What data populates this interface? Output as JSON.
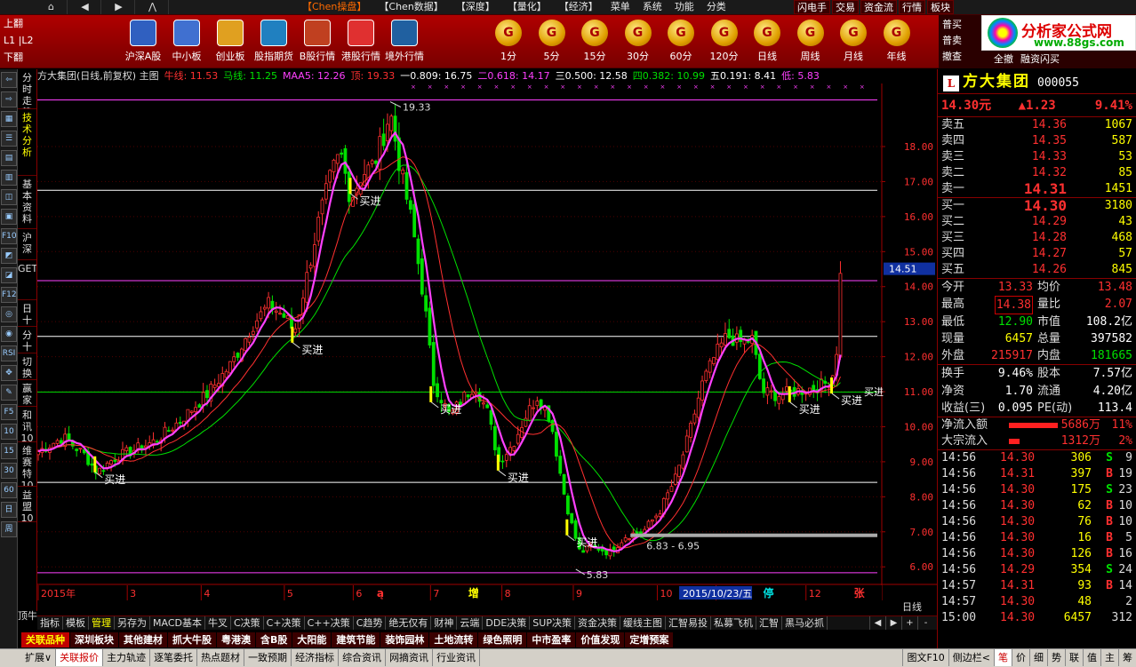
{
  "menubar": {
    "nav": [
      "⌂",
      "◀",
      "▶",
      "⋀"
    ],
    "items": [
      "【Chen操盘】",
      "【Chen数据】",
      "【深度】",
      "【量化】",
      "【经济】",
      "菜单",
      "系统",
      "功能",
      "分类"
    ],
    "highlight_index": 0,
    "right_buttons": [
      "闪电手",
      "交易",
      "资金流",
      "行情",
      "板块"
    ]
  },
  "toolbar": {
    "left": [
      "上翻",
      "L1 |L2",
      "下翻"
    ],
    "items": [
      {
        "label": "沪深A股",
        "icon": "chart-grid-icon"
      },
      {
        "label": "中小板",
        "icon": "tiles-icon"
      },
      {
        "label": "创业板",
        "icon": "pencil-chart-icon"
      },
      {
        "label": "股指期货",
        "icon": "futures-icon"
      },
      {
        "label": "B股行情",
        "icon": "building-icon"
      },
      {
        "label": "港股行情",
        "icon": "hk-flower-icon"
      },
      {
        "label": "境外行情",
        "icon": "globe-search-icon"
      }
    ],
    "periods": [
      "1分",
      "5分",
      "15分",
      "30分",
      "60分",
      "120分",
      "日线",
      "周线",
      "月线",
      "年线"
    ],
    "coin_glyph": "G"
  },
  "logo": {
    "name": "分析家公式网",
    "url": "www.88gs.com",
    "side": [
      "普买",
      "普卖",
      "撤查"
    ],
    "bottom": [
      "全撤",
      "融资闪买"
    ]
  },
  "chart_header": {
    "title": "方大集团(日线,前复权) 主图",
    "items": [
      {
        "text": "牛线: 11.53",
        "color": "#ff3030"
      },
      {
        "text": "马线: 11.25",
        "color": "#00e000"
      },
      {
        "text": "MAA5: 12.26",
        "color": "#ff40ff"
      },
      {
        "text": "顶: 19.33",
        "color": "#ff3030"
      },
      {
        "text": "一0.809: 16.75",
        "color": "#ffffff"
      },
      {
        "text": "二0.618: 14.17",
        "color": "#ff40ff"
      },
      {
        "text": "三0.500: 12.58",
        "color": "#ffffff"
      },
      {
        "text": "四0.382: 10.99",
        "color": "#00e000"
      },
      {
        "text": "五0.191: 8.41",
        "color": "#ffffff"
      },
      {
        "text": "低: 5.83",
        "color": "#ff40ff"
      }
    ]
  },
  "chart_data": {
    "type": "candlestick",
    "y_ticks": [
      6.0,
      7.0,
      8.0,
      9.0,
      10.0,
      11.0,
      12.0,
      13.0,
      14.0,
      15.0,
      16.0,
      17.0,
      18.0
    ],
    "ylim": [
      5.6,
      19.8
    ],
    "current_price_tag": "14.51",
    "month_labels": [
      {
        "label": "2015年",
        "pos": 0.0
      },
      {
        "label": "3",
        "pos": 0.106
      },
      {
        "label": "4",
        "pos": 0.194
      },
      {
        "label": "5",
        "pos": 0.293
      },
      {
        "label": "6",
        "pos": 0.375
      },
      {
        "label": "7",
        "pos": 0.467
      },
      {
        "label": "8",
        "pos": 0.552
      },
      {
        "label": "9",
        "pos": 0.637
      },
      {
        "label": "10",
        "pos": 0.737
      },
      {
        "label": "11",
        "pos": 0.807
      },
      {
        "label": "12",
        "pos": 0.914
      }
    ],
    "special_labels": [
      {
        "label": "ą",
        "pos": 0.403,
        "color": "#ff3030"
      },
      {
        "label": "增",
        "pos": 0.512,
        "color": "#ffff00"
      },
      {
        "label": "财",
        "pos": 0.777,
        "color": "#4080ff"
      },
      {
        "label": "停",
        "pos": 0.863,
        "color": "#00e0e0"
      },
      {
        "label": "张",
        "pos": 0.971,
        "color": "#ff3030"
      }
    ],
    "date_box": "2015/10/23/五",
    "fib_levels": [
      {
        "name": "顶",
        "value": 19.33,
        "color": "#ff40ff"
      },
      {
        "name": "一0.809",
        "value": 16.75,
        "color": "#ffffff"
      },
      {
        "name": "二0.618",
        "value": 14.17,
        "color": "#ff40ff"
      },
      {
        "name": "三0.500",
        "value": 12.58,
        "color": "#ffffff"
      },
      {
        "name": "四0.382",
        "value": 10.99,
        "color": "#00e000"
      },
      {
        "name": "五0.191",
        "value": 8.41,
        "color": "#ffffff"
      },
      {
        "name": "低",
        "value": 5.83,
        "color": "#ff40ff"
      }
    ],
    "annotations": {
      "high": {
        "label": "19.33",
        "pos": 0.419,
        "value": 19.33
      },
      "low": {
        "label": "5.83",
        "pos": 0.64,
        "value": 5.83
      },
      "range": {
        "label": "6.83 - 6.95",
        "pos": 0.705,
        "value": 6.9
      },
      "buy_label": "买进",
      "buy_signals": [
        {
          "pos": 0.068,
          "value": 8.75
        },
        {
          "pos": 0.372,
          "value": 16.7
        },
        {
          "pos": 0.303,
          "value": 12.45
        },
        {
          "pos": 0.468,
          "value": 10.75
        },
        {
          "pos": 0.548,
          "value": 8.8
        },
        {
          "pos": 0.63,
          "value": 6.95
        },
        {
          "pos": 0.895,
          "value": 10.75
        },
        {
          "pos": 0.945,
          "value": 11.0
        }
      ]
    },
    "close_anchors": [
      [
        0.0,
        9.3
      ],
      [
        0.03,
        9.7
      ],
      [
        0.055,
        9.2
      ],
      [
        0.07,
        8.7
      ],
      [
        0.09,
        9.1
      ],
      [
        0.11,
        9.3
      ],
      [
        0.14,
        9.6
      ],
      [
        0.17,
        10.2
      ],
      [
        0.2,
        10.9
      ],
      [
        0.23,
        11.8
      ],
      [
        0.255,
        12.9
      ],
      [
        0.275,
        13.5
      ],
      [
        0.295,
        13.1
      ],
      [
        0.305,
        12.7
      ],
      [
        0.32,
        14.3
      ],
      [
        0.335,
        16.0
      ],
      [
        0.35,
        17.3
      ],
      [
        0.36,
        17.8
      ],
      [
        0.372,
        16.5
      ],
      [
        0.385,
        17.2
      ],
      [
        0.4,
        17.5
      ],
      [
        0.412,
        18.4
      ],
      [
        0.419,
        19.0
      ],
      [
        0.43,
        17.5
      ],
      [
        0.445,
        15.8
      ],
      [
        0.46,
        13.5
      ],
      [
        0.47,
        11.3
      ],
      [
        0.49,
        10.3
      ],
      [
        0.505,
        10.8
      ],
      [
        0.52,
        11.2
      ],
      [
        0.535,
        10.4
      ],
      [
        0.548,
        9.0
      ],
      [
        0.565,
        9.5
      ],
      [
        0.58,
        10.3
      ],
      [
        0.595,
        10.9
      ],
      [
        0.61,
        10.2
      ],
      [
        0.625,
        8.2
      ],
      [
        0.635,
        7.2
      ],
      [
        0.645,
        6.4
      ],
      [
        0.66,
        6.6
      ],
      [
        0.68,
        6.4
      ],
      [
        0.7,
        6.9
      ],
      [
        0.72,
        7.0
      ],
      [
        0.74,
        7.6
      ],
      [
        0.76,
        8.6
      ],
      [
        0.775,
        9.8
      ],
      [
        0.79,
        11.2
      ],
      [
        0.805,
        12.0
      ],
      [
        0.82,
        12.6
      ],
      [
        0.835,
        12.4
      ],
      [
        0.85,
        12.5
      ],
      [
        0.862,
        11.0
      ],
      [
        0.88,
        10.9
      ],
      [
        0.9,
        11.0
      ],
      [
        0.92,
        11.1
      ],
      [
        0.935,
        11.2
      ],
      [
        0.945,
        11.4
      ],
      [
        0.95,
        12.0
      ],
      [
        0.955,
        14.3
      ]
    ]
  },
  "lefttabs": [
    {
      "label": "分时走势",
      "active": false
    },
    {
      "label": "技术分析",
      "active": true
    },
    {
      "label": "基本资料",
      "active": false
    },
    {
      "label": "沪深",
      "active": false
    },
    {
      "label": "GET",
      "active": false
    },
    {
      "label": "日十",
      "active": false
    },
    {
      "label": "分十",
      "active": false
    },
    {
      "label": "切换",
      "active": false
    },
    {
      "label": "赢家",
      "active": false
    },
    {
      "label": "和讯10",
      "active": false
    },
    {
      "label": "维赛特10",
      "active": false
    },
    {
      "label": "益盟10",
      "active": false
    }
  ],
  "lefticons": [
    "⇦",
    "⇨",
    "▦",
    "☰",
    "▤",
    "▥",
    "◫",
    "▣",
    "F10",
    "◩",
    "◪",
    "F12",
    "◎",
    "◉",
    "RSI",
    "✥",
    "✎",
    "F5",
    "10",
    "15",
    "30",
    "60",
    "日",
    "周"
  ],
  "sidebar_v": "顶牛",
  "bottomtabs": [
    "指标",
    "模板",
    "管理",
    "另存为",
    "MACD基本",
    "牛叉",
    "C决策",
    "C+决策",
    "C++决策",
    "C趋势",
    "绝无仅有",
    "财神",
    "云端",
    "DDE决策",
    "SUP决策",
    "资金决策",
    "缓线主图",
    "汇智易投",
    "私募飞机",
    "汇智",
    "黑马必抓"
  ],
  "bottomtabs_active": 2,
  "timeframe": "日线",
  "navarrows": [
    "◀",
    "▶",
    "+",
    "-"
  ],
  "sectors": [
    "关联品种",
    "深圳板块",
    "其他建材",
    "抓大牛股",
    "粤港澳",
    "含B股",
    "大阳能",
    "建筑节能",
    "装饰园林",
    "土地流转",
    "绿色照明",
    "中市盈率",
    "价值发现",
    "定增预案"
  ],
  "statusbar": {
    "items": [
      "扩展∨",
      "关联报价",
      "主力轨迹",
      "逐笔委托",
      "热点题材",
      "一致预期",
      "经济指标",
      "综合资讯",
      "网摘资讯",
      "行业资讯"
    ],
    "active": 1,
    "right": [
      "图文F10",
      "侧边栏<",
      "笔",
      "价",
      "细",
      "势",
      "联",
      "值",
      "主",
      "筹"
    ]
  },
  "quote": {
    "logo": "L",
    "name": "方大集团",
    "code": "000055",
    "price": "14.30元",
    "change": "▲1.23",
    "change_pct": "9.41%",
    "asks": [
      {
        "label": "卖五",
        "price": "14.36",
        "vol": "1067"
      },
      {
        "label": "卖四",
        "price": "14.35",
        "vol": "587"
      },
      {
        "label": "卖三",
        "price": "14.33",
        "vol": "53"
      },
      {
        "label": "卖二",
        "price": "14.32",
        "vol": "85"
      },
      {
        "label": "卖一",
        "price": "14.31",
        "vol": "1451"
      }
    ],
    "bids": [
      {
        "label": "买一",
        "price": "14.30",
        "vol": "3180"
      },
      {
        "label": "买二",
        "price": "14.29",
        "vol": "43"
      },
      {
        "label": "买三",
        "price": "14.28",
        "vol": "468"
      },
      {
        "label": "买四",
        "price": "14.27",
        "vol": "57"
      },
      {
        "label": "买五",
        "price": "14.26",
        "vol": "845"
      }
    ],
    "stats": [
      {
        "k1": "今开",
        "v1": "13.33",
        "c1": "red",
        "k2": "均价",
        "v2": "13.48",
        "c2": "red"
      },
      {
        "k1": "最高",
        "v1": "14.38",
        "c1": "red",
        "b1": true,
        "k2": "量比",
        "v2": "2.07",
        "c2": "red"
      },
      {
        "k1": "最低",
        "v1": "12.90",
        "c1": "grn",
        "k2": "市值",
        "v2": "108.2亿",
        "c2": "wht"
      },
      {
        "k1": "现量",
        "v1": "6457",
        "c1": "yel",
        "k2": "总量",
        "v2": "397582",
        "c2": "wht"
      },
      {
        "k1": "外盘",
        "v1": "215917",
        "c1": "red",
        "k2": "内盘",
        "v2": "181665",
        "c2": "grn"
      }
    ],
    "stats2": [
      {
        "k1": "换手",
        "v1": "9.46%",
        "c1": "wht",
        "k2": "股本",
        "v2": "7.57亿",
        "c2": "wht"
      },
      {
        "k1": "净资",
        "v1": "1.70",
        "c1": "wht",
        "k2": "流通",
        "v2": "4.20亿",
        "c2": "wht"
      },
      {
        "k1": "收益(三)",
        "v1": "0.095",
        "c1": "wht",
        "k2": "PE(动)",
        "v2": "113.4",
        "c2": "wht"
      }
    ],
    "flows": [
      {
        "label": "净流入额",
        "value": "5686万",
        "pct": "11%",
        "bar": 0.55
      },
      {
        "label": "大宗流入",
        "value": "1312万",
        "pct": "2%",
        "bar": 0.12
      }
    ],
    "ticks": [
      {
        "t": "14:56",
        "p": "14.30",
        "v": "306",
        "s": "S",
        "n": "9"
      },
      {
        "t": "14:56",
        "p": "14.31",
        "v": "397",
        "s": "B",
        "n": "19"
      },
      {
        "t": "14:56",
        "p": "14.30",
        "v": "175",
        "s": "S",
        "n": "23"
      },
      {
        "t": "14:56",
        "p": "14.30",
        "v": "62",
        "s": "B",
        "n": "10"
      },
      {
        "t": "14:56",
        "p": "14.30",
        "v": "76",
        "s": "B",
        "n": "10"
      },
      {
        "t": "14:56",
        "p": "14.30",
        "v": "16",
        "s": "B",
        "n": "5"
      },
      {
        "t": "14:56",
        "p": "14.30",
        "v": "126",
        "s": "B",
        "n": "16"
      },
      {
        "t": "14:56",
        "p": "14.29",
        "v": "354",
        "s": "S",
        "n": "24"
      },
      {
        "t": "14:57",
        "p": "14.31",
        "v": "93",
        "s": "B",
        "n": "14"
      },
      {
        "t": "14:57",
        "p": "14.30",
        "v": "48",
        "s": "",
        "n": "2"
      },
      {
        "t": "15:00",
        "p": "14.30",
        "v": "6457",
        "s": "",
        "n": "312"
      }
    ]
  }
}
